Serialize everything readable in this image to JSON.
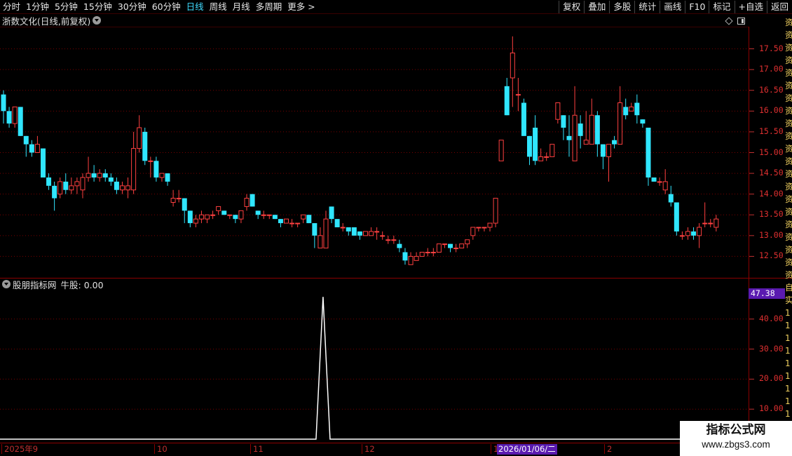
{
  "toolbar": {
    "left": [
      "分时",
      "1分钟",
      "5分钟",
      "15分钟",
      "30分钟",
      "60分钟",
      "日线",
      "周线",
      "月线",
      "多周期",
      "更多 >"
    ],
    "active": "日线",
    "right": [
      "复权",
      "叠加",
      "多股",
      "统计",
      "画线",
      "F10",
      "标记",
      "+自选",
      "返回"
    ]
  },
  "main_panel": {
    "stock_name": "浙数文化",
    "period_label": "(日线,前复权)",
    "price_axis": [
      "17.50",
      "17.00",
      "16.50",
      "16.00",
      "15.50",
      "15.00",
      "14.50",
      "14.00",
      "13.50",
      "13.00",
      "12.50"
    ]
  },
  "indicator_panel": {
    "title": "股朋指标网",
    "signal_label": "牛股: 0.00",
    "current_value": "47.38",
    "axis": [
      "40.00",
      "30.00",
      "20.00",
      "10.00"
    ]
  },
  "date_axis": {
    "labels": [
      "2025年9",
      "10",
      "11",
      "12",
      "1",
      "2"
    ],
    "cursor": "2026/01/06/二"
  },
  "watermark": {
    "title": "指标公式网",
    "url": "www.zbgs3.com"
  },
  "info_strip": [
    "资",
    "资",
    "资",
    "资",
    "资",
    "资",
    "资",
    "资",
    "资",
    "资",
    "资",
    "资",
    "资",
    "资",
    "资",
    "资",
    "资",
    "资",
    "资",
    "资",
    "资",
    "自",
    "实",
    "1",
    "1",
    "1",
    "1",
    "1",
    "1",
    "1",
    "1",
    "1"
  ],
  "colors": {
    "up": "#ff4040",
    "down": "#30e6ff",
    "grid": "#7a0000",
    "signal": "#ffffff",
    "cursor_box": "#5a1ab0"
  },
  "chart_data": {
    "type": "candlestick",
    "price_ylim": [
      12.0,
      18.0
    ],
    "indicator_ylim": [
      0,
      50
    ],
    "candles": [
      [
        16.4,
        16.0,
        16.5,
        15.7
      ],
      [
        16.0,
        15.7,
        16.1,
        15.6
      ],
      [
        15.7,
        16.1,
        16.1,
        15.6
      ],
      [
        16.1,
        15.4,
        16.1,
        15.4
      ],
      [
        15.4,
        15.2,
        15.4,
        14.9
      ],
      [
        15.2,
        15.0,
        15.3,
        14.9
      ],
      [
        15.0,
        15.2,
        15.4,
        15.0
      ],
      [
        15.1,
        14.4,
        15.1,
        14.4
      ],
      [
        14.4,
        14.2,
        14.5,
        14.1
      ],
      [
        14.2,
        13.9,
        14.3,
        13.6
      ],
      [
        14.0,
        14.3,
        14.4,
        13.9
      ],
      [
        14.3,
        14.1,
        14.5,
        14.0
      ],
      [
        14.1,
        14.2,
        14.4,
        14.0
      ],
      [
        14.2,
        14.3,
        14.4,
        14.0
      ],
      [
        14.1,
        14.4,
        14.5,
        13.9
      ],
      [
        14.4,
        14.5,
        14.9,
        14.3
      ],
      [
        14.5,
        14.4,
        14.7,
        14.3
      ],
      [
        14.4,
        14.5,
        14.6,
        14.3
      ],
      [
        14.5,
        14.4,
        14.6,
        14.3
      ],
      [
        14.4,
        14.3,
        14.5,
        14.2
      ],
      [
        14.3,
        14.1,
        14.4,
        14.0
      ],
      [
        14.1,
        14.2,
        14.3,
        14.0
      ],
      [
        14.1,
        14.2,
        14.4,
        13.9
      ],
      [
        14.1,
        15.1,
        15.5,
        14.0
      ],
      [
        15.1,
        15.6,
        15.9,
        15.0
      ],
      [
        15.5,
        14.8,
        15.6,
        14.7
      ],
      [
        14.8,
        14.8,
        14.9,
        14.4
      ],
      [
        14.8,
        14.4,
        14.9,
        14.3
      ],
      [
        14.4,
        14.5,
        14.5,
        14.3
      ],
      [
        14.5,
        14.3,
        14.5,
        14.2
      ],
      [
        13.8,
        13.9,
        14.1,
        13.7
      ],
      [
        13.9,
        13.9,
        14.1,
        13.8
      ],
      [
        13.9,
        13.6,
        13.9,
        13.3
      ],
      [
        13.6,
        13.3,
        13.6,
        13.2
      ],
      [
        13.3,
        13.4,
        13.5,
        13.2
      ],
      [
        13.4,
        13.5,
        13.6,
        13.3
      ],
      [
        13.4,
        13.5,
        13.5,
        13.3
      ],
      [
        13.5,
        13.5,
        13.6,
        13.4
      ],
      [
        13.6,
        13.7,
        13.7,
        13.5
      ],
      [
        13.6,
        13.5,
        13.6,
        13.5
      ],
      [
        13.5,
        13.5,
        13.5,
        13.4
      ],
      [
        13.5,
        13.4,
        13.5,
        13.3
      ],
      [
        13.4,
        13.6,
        13.6,
        13.3
      ],
      [
        13.7,
        13.9,
        14.0,
        13.6
      ],
      [
        14.0,
        13.7,
        14.0,
        13.7
      ],
      [
        13.6,
        13.5,
        13.6,
        13.4
      ],
      [
        13.5,
        13.5,
        13.6,
        13.4
      ],
      [
        13.5,
        13.5,
        13.5,
        13.4
      ],
      [
        13.5,
        13.4,
        13.5,
        13.4
      ],
      [
        13.4,
        13.3,
        13.4,
        13.2
      ],
      [
        13.3,
        13.4,
        13.4,
        13.3
      ],
      [
        13.3,
        13.3,
        13.4,
        13.2
      ],
      [
        13.3,
        13.3,
        13.3,
        13.2
      ],
      [
        13.4,
        13.5,
        13.5,
        13.3
      ],
      [
        13.5,
        13.3,
        13.5,
        13.3
      ],
      [
        13.3,
        13.0,
        13.3,
        12.7
      ],
      [
        12.7,
        13.0,
        13.2,
        12.7
      ],
      [
        12.7,
        13.4,
        13.6,
        12.7
      ],
      [
        13.7,
        13.4,
        13.7,
        13.3
      ],
      [
        13.4,
        13.2,
        13.3,
        13.2
      ],
      [
        13.2,
        13.2,
        13.3,
        13.1
      ],
      [
        13.2,
        13.1,
        13.1,
        13.0
      ],
      [
        13.2,
        13.0,
        13.2,
        13.0
      ],
      [
        13.1,
        13.0,
        13.1,
        12.9
      ],
      [
        13.0,
        13.1,
        13.1,
        13.0
      ],
      [
        13.0,
        13.1,
        13.2,
        13.0
      ],
      [
        13.1,
        13.1,
        13.2,
        12.9
      ],
      [
        13.0,
        13.0,
        13.1,
        12.9
      ],
      [
        12.9,
        12.9,
        13.0,
        12.8
      ],
      [
        12.9,
        12.9,
        13.0,
        12.8
      ],
      [
        12.8,
        12.7,
        12.9,
        12.6
      ],
      [
        12.6,
        12.4,
        12.7,
        12.3
      ],
      [
        12.3,
        12.5,
        12.6,
        12.3
      ],
      [
        12.4,
        12.5,
        12.6,
        12.4
      ],
      [
        12.5,
        12.6,
        12.6,
        12.5
      ],
      [
        12.6,
        12.6,
        12.7,
        12.5
      ],
      [
        12.6,
        12.6,
        12.7,
        12.5
      ],
      [
        12.6,
        12.8,
        12.8,
        12.6
      ],
      [
        12.8,
        12.8,
        12.8,
        12.7
      ],
      [
        12.8,
        12.7,
        12.8,
        12.6
      ],
      [
        12.7,
        12.7,
        12.8,
        12.6
      ],
      [
        12.7,
        12.8,
        12.8,
        12.7
      ],
      [
        12.8,
        12.9,
        12.9,
        12.7
      ],
      [
        13.0,
        13.2,
        13.2,
        12.9
      ],
      [
        13.2,
        13.2,
        13.2,
        13.1
      ],
      [
        13.2,
        13.2,
        13.2,
        13.1
      ],
      [
        13.2,
        13.3,
        13.3,
        13.1
      ],
      [
        13.3,
        13.9,
        13.9,
        13.2
      ],
      [
        14.8,
        15.3,
        15.3,
        14.8
      ],
      [
        16.6,
        15.9,
        16.8,
        15.9
      ],
      [
        16.8,
        17.4,
        17.8,
        16.1
      ],
      [
        16.4,
        16.4,
        16.8,
        16.0
      ],
      [
        16.2,
        15.4,
        16.3,
        15.4
      ],
      [
        15.4,
        14.9,
        15.4,
        14.7
      ],
      [
        15.6,
        14.8,
        15.9,
        14.7
      ],
      [
        14.8,
        14.9,
        15.1,
        14.8
      ],
      [
        14.9,
        14.9,
        15.0,
        14.8
      ],
      [
        14.9,
        15.2,
        15.2,
        14.9
      ],
      [
        15.8,
        16.2,
        16.2,
        15.7
      ],
      [
        15.9,
        15.6,
        15.9,
        15.3
      ],
      [
        15.4,
        15.3,
        15.9,
        14.9
      ],
      [
        14.8,
        15.9,
        16.6,
        14.8
      ],
      [
        15.7,
        15.4,
        15.9,
        15.1
      ],
      [
        15.2,
        15.3,
        16.0,
        15.2
      ],
      [
        15.2,
        15.9,
        16.3,
        15.2
      ],
      [
        15.9,
        15.2,
        16.0,
        14.9
      ],
      [
        15.2,
        14.9,
        15.2,
        14.6
      ],
      [
        14.9,
        15.2,
        15.2,
        14.3
      ],
      [
        15.3,
        15.2,
        15.4,
        15.1
      ],
      [
        15.2,
        16.2,
        16.6,
        15.2
      ],
      [
        16.1,
        15.9,
        16.3,
        15.8
      ],
      [
        16.0,
        16.1,
        16.2,
        16.0
      ],
      [
        16.2,
        15.9,
        16.4,
        15.7
      ],
      [
        15.8,
        15.7,
        15.8,
        15.6
      ],
      [
        15.6,
        14.4,
        15.6,
        14.2
      ],
      [
        14.4,
        14.3,
        14.4,
        14.3
      ],
      [
        14.3,
        14.3,
        14.4,
        14.2
      ],
      [
        14.1,
        14.3,
        14.6,
        14.0
      ],
      [
        14.0,
        13.8,
        14.2,
        13.7
      ],
      [
        13.8,
        13.1,
        13.8,
        13.0
      ],
      [
        13.0,
        13.0,
        13.1,
        12.9
      ],
      [
        13.0,
        13.1,
        13.2,
        12.9
      ],
      [
        13.1,
        13.0,
        13.2,
        12.9
      ],
      [
        13.0,
        13.2,
        13.3,
        12.7
      ],
      [
        13.3,
        13.3,
        13.8,
        13.2
      ],
      [
        13.3,
        13.3,
        13.4,
        13.2
      ],
      [
        13.2,
        13.4,
        13.5,
        13.1
      ]
    ],
    "indicator_series": {
      "name": "牛股",
      "spike_index": 56,
      "spike_value": 47.38,
      "baseline": 0
    }
  }
}
